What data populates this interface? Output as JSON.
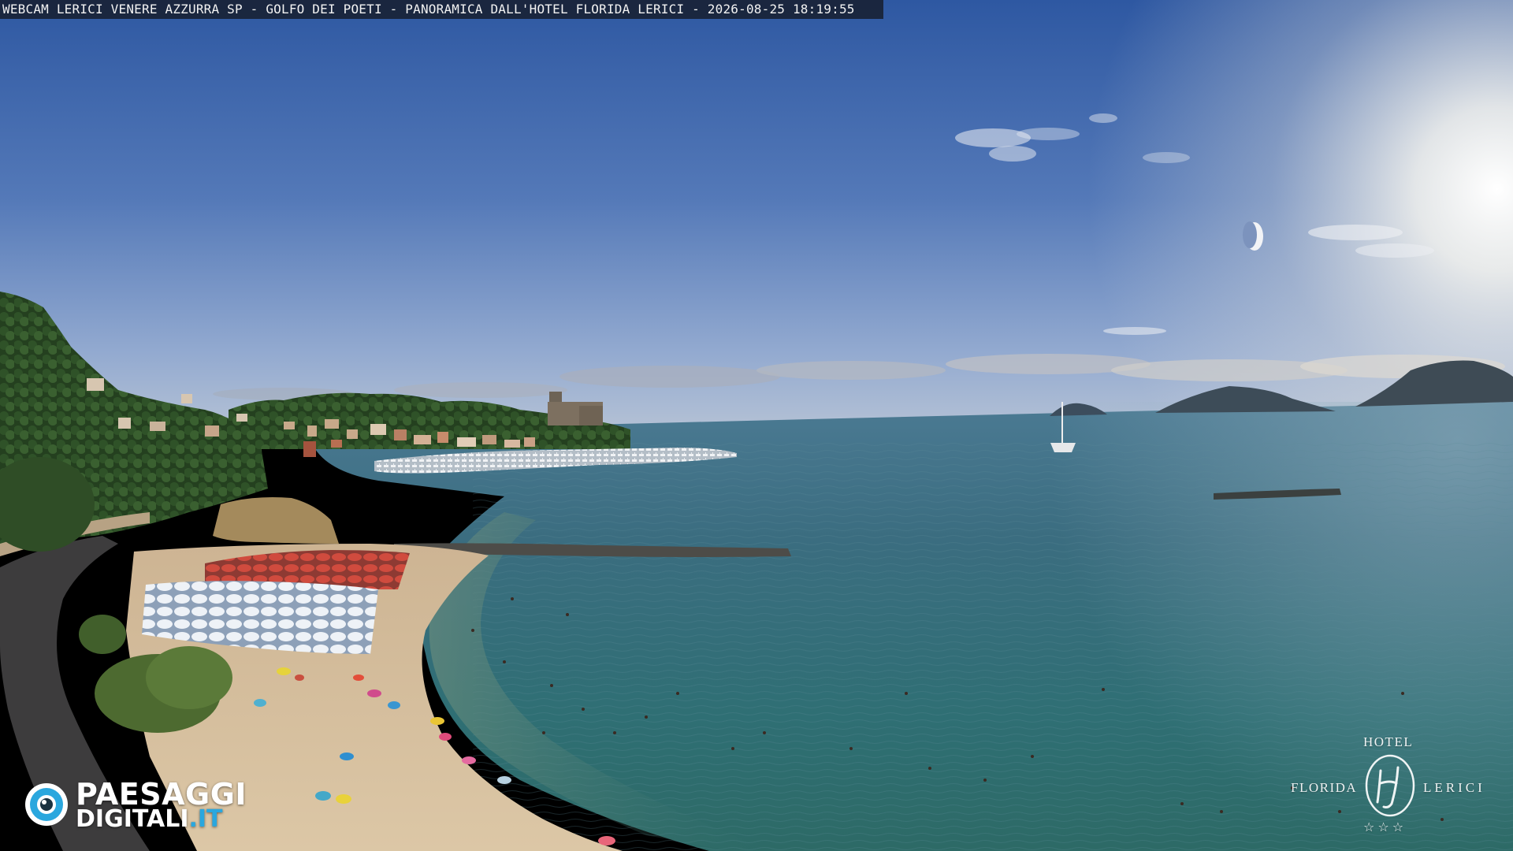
{
  "caption": {
    "text": "WEBCAM LERICI VENERE AZZURRA SP - GOLFO DEI POETI - PANORAMICA DALL'HOTEL FLORIDA LERICI - 2026-08-25 18:19:55"
  },
  "watermark_left": {
    "brand_line1": "PAESAGGI",
    "brand_line2": "DIGITALI",
    "brand_tld": ".IT",
    "icon": "eye-camera-icon"
  },
  "watermark_right": {
    "hotel_word": "HOTEL",
    "name_left": "FLORIDA",
    "name_right": "LERICI",
    "stars": "☆☆☆",
    "icon": "hf-monogram-icon"
  },
  "colors": {
    "sky_top": "#2f5aa4",
    "sky_horizon": "#a9bcd8",
    "sea_far": "#3f6f86",
    "sea_near": "#2c6f73",
    "beach_sand": "#d9c3a1",
    "umbrella_red": "#c9483c",
    "umbrella_white": "#eef2f6",
    "accent_blue": "#2aa7de"
  }
}
